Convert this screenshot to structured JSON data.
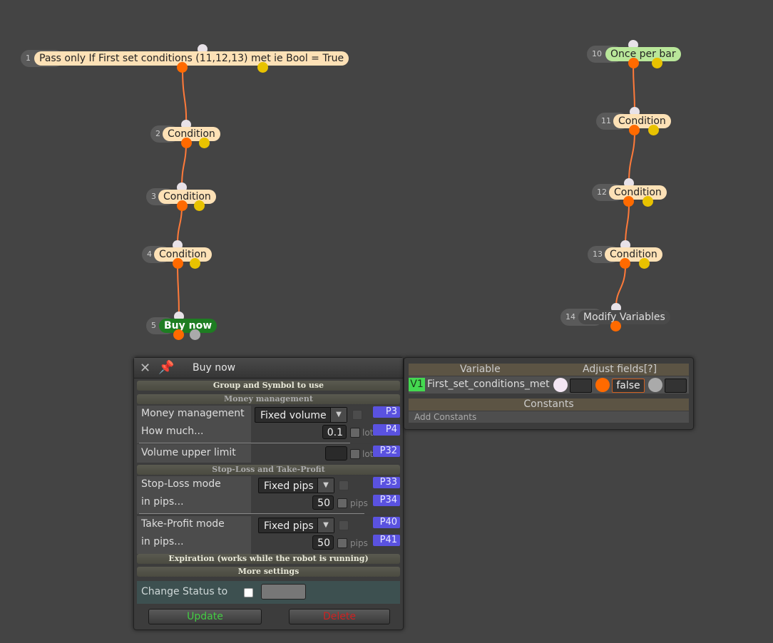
{
  "nodes": [
    {
      "id": "1",
      "label": "Pass only If First set conditions (11,12,13) met ie Bool = True"
    },
    {
      "id": "2",
      "label": "Condition"
    },
    {
      "id": "3",
      "label": "Condition"
    },
    {
      "id": "4",
      "label": "Condition"
    },
    {
      "id": "5",
      "label": "Buy now"
    },
    {
      "id": "10",
      "label": "Once per bar"
    },
    {
      "id": "11",
      "label": "Condition"
    },
    {
      "id": "12",
      "label": "Condition"
    },
    {
      "id": "13",
      "label": "Condition"
    },
    {
      "id": "14",
      "label": "Modify Variables"
    }
  ],
  "panel": {
    "close_icon": "✕",
    "pin_icon": "📌",
    "title": "Buy now",
    "sections": {
      "group": "Group and Symbol to use",
      "money": "Money management",
      "sltp": "Stop-Loss and Take-Profit",
      "expiration": "Expiration (works while the robot is running)",
      "more": "More settings"
    },
    "money_management": {
      "label": "Money management",
      "value": "Fixed volume",
      "tag": "P3"
    },
    "how_much": {
      "label": "How much...",
      "value": "0.1",
      "unit": "lots",
      "tag": "P4"
    },
    "volume_upper": {
      "label": "Volume upper limit",
      "value": "",
      "unit": "lots",
      "tag": "P32"
    },
    "sl_mode": {
      "label": "Stop-Loss mode",
      "value": "Fixed pips",
      "tag": "P33"
    },
    "sl_pips": {
      "label": "in pips...",
      "value": "50",
      "unit": "pips",
      "tag": "P34"
    },
    "tp_mode": {
      "label": "Take-Profit mode",
      "value": "Fixed pips",
      "tag": "P40"
    },
    "tp_pips": {
      "label": "in pips...",
      "value": "50",
      "unit": "pips",
      "tag": "P41"
    },
    "change_status": {
      "label": "Change Status to",
      "value": ""
    },
    "update_label": "Update",
    "delete_label": "Delete"
  },
  "variables": {
    "col_variable": "Variable",
    "col_adjust": "Adjust fields[?]",
    "row": {
      "tag": "V1",
      "name": "First_set_conditions_met",
      "value": "false"
    },
    "constants_header": "Constants",
    "add_constants": "Add Constants"
  },
  "colors": {
    "background": "#444444",
    "condition_node": "#fde1b6",
    "once_per_bar": "#b9e79a",
    "buy_now": "#1e7d22",
    "out_port": "#ff6a00",
    "alt_port": "#e8c200",
    "param_tag": "#5a52e0",
    "update": "#44cc44",
    "delete": "#cc2222"
  }
}
